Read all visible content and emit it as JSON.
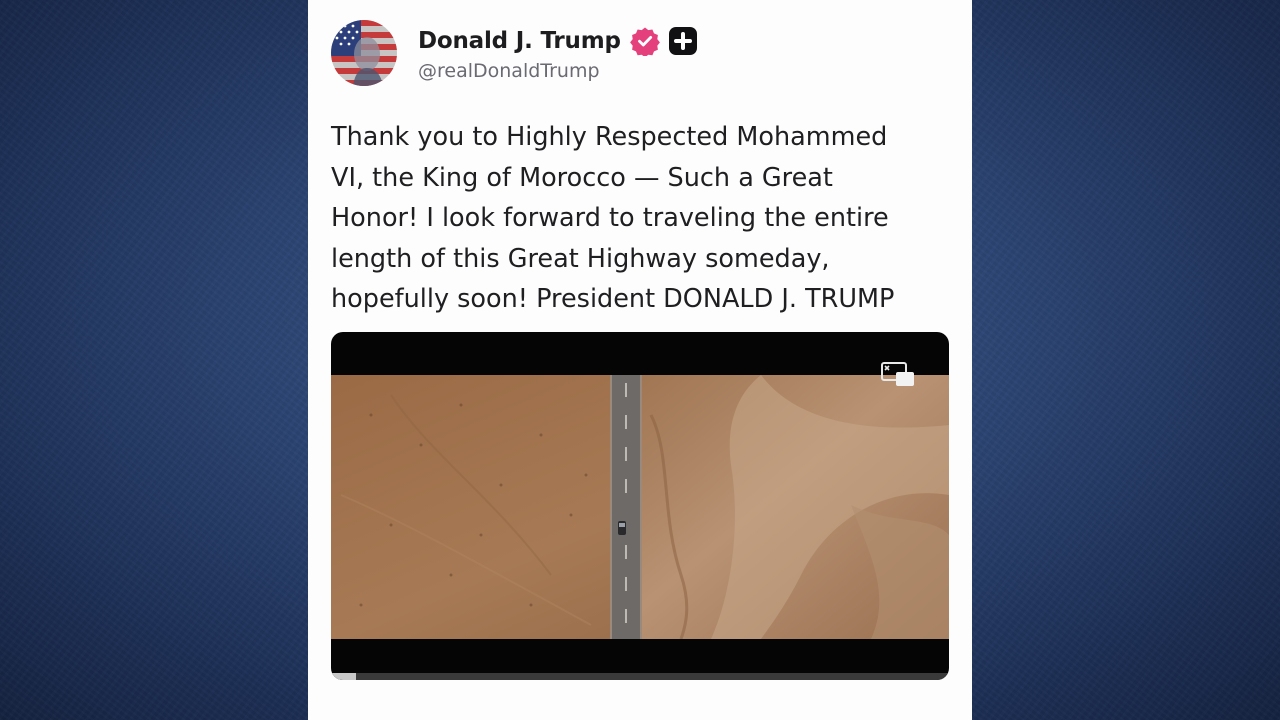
{
  "post": {
    "author": {
      "display_name": "Donald J. Trump",
      "handle": "@realDonaldTrump",
      "verified_icon": "verified-badge-icon",
      "verified_color": "#e4407b",
      "badge_icon": "plus-badge-icon"
    },
    "text": "Thank you to Highly Respected Mohammed\nVI, the King of Morocco — Such a Great\nHonor! I look forward to traveling the entire\nlength of this Great Highway someday,\nhopefully soon! President DONALD J. TRUMP",
    "video": {
      "progress": 0.04,
      "pip_icon": "picture-in-picture-icon"
    }
  },
  "colors": {
    "background": "#2a4270",
    "card": "#fdfdfd",
    "text": "#1f1f22",
    "handle": "#6a6a72"
  }
}
